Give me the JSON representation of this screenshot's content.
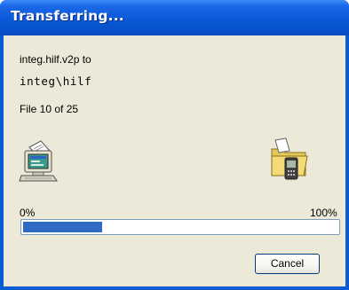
{
  "window": {
    "title": "Transferring..."
  },
  "transfer": {
    "source_line": "integ.hilf.v2p to",
    "destination": "integ\\hilf",
    "file_counter": "File 10 of 25"
  },
  "icons": {
    "source": "desktop-computer-icon",
    "destination": "handheld-folder-icon"
  },
  "progress": {
    "min_label": "0%",
    "max_label": "100%",
    "value": 0.25
  },
  "buttons": {
    "cancel_label": "Cancel"
  },
  "colors": {
    "title_bar": "#0a58d8",
    "window_frame": "#0a5bd6",
    "dialog_face": "#ece9d8",
    "progress_fill": "#316ac5"
  }
}
